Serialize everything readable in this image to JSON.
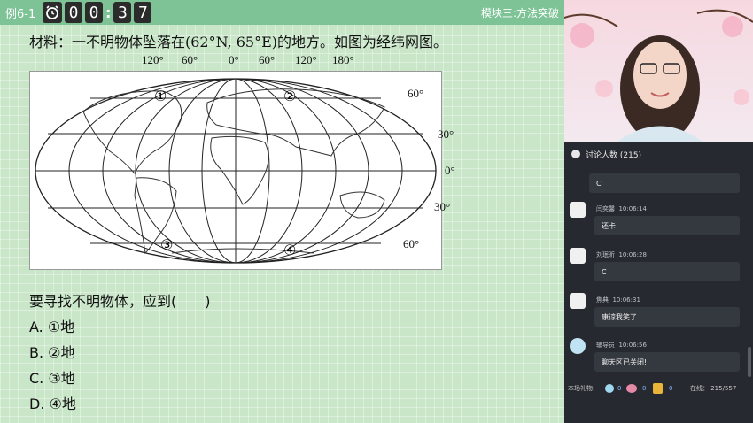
{
  "header": {
    "example_label": "例6-1",
    "timer": [
      "0",
      "0",
      "3",
      "7"
    ],
    "module": "模块三:方法突破"
  },
  "material": "材料：一不明物体坠落在(62°N, 65°E)的地方。如图为经纬网图。",
  "map": {
    "lon_labels": [
      "120°",
      "60°",
      "0°",
      "60°",
      "120°",
      "180°"
    ],
    "lat_labels": [
      "60°",
      "30°",
      "0°",
      "30°",
      "60°"
    ],
    "points": [
      "①",
      "②",
      "③",
      "④"
    ]
  },
  "question": "要寻找不明物体，应到(　　)",
  "options": [
    "A. ①地",
    "B. ②地",
    "C. ③地",
    "D. ④地"
  ],
  "sidebar": {
    "chat_title": "讨论人数 (215)",
    "messages": [
      {
        "name": "",
        "time": "",
        "text": "C"
      },
      {
        "name": "闫奕馨",
        "time": "10:06:14",
        "text": "还卡"
      },
      {
        "name": "刘珉昕",
        "time": "10:06:28",
        "text": "C"
      },
      {
        "name": "焦典",
        "time": "10:06:31",
        "text": "康谅我笑了"
      },
      {
        "name": "辅导员",
        "time": "10:06:56",
        "text": "聊天区已关闭!"
      }
    ],
    "gifts_label": "本场礼物:",
    "gift_counts": [
      "0",
      "0",
      "0"
    ],
    "online": "在线： 215/557"
  }
}
